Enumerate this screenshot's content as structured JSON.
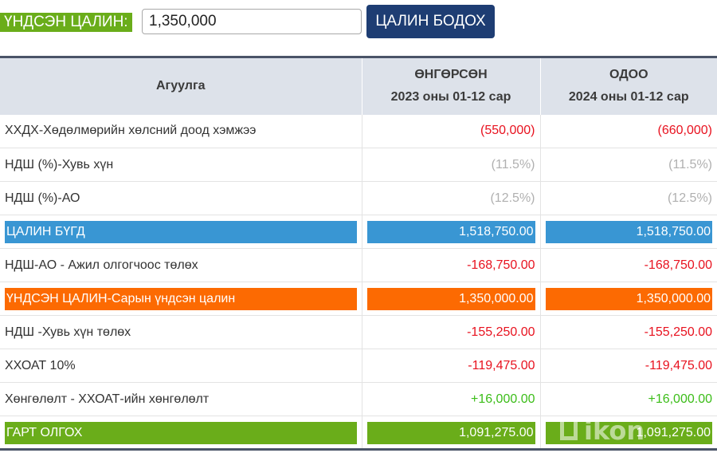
{
  "topbar": {
    "base_salary_label": "ҮНДСЭН ЦАЛИН:",
    "salary_input_value": "1,350,000",
    "calc_button_label": "ЦАЛИН БОДОХ"
  },
  "table": {
    "headers": {
      "content": "Агуулга",
      "past": {
        "title": "ӨНГӨРСӨН",
        "period": "2023 оны 01-12 сар"
      },
      "current": {
        "title": "ОДОО",
        "period": "2024 оны 01-12 сар"
      }
    },
    "rows": [
      {
        "label": "ХХДХ-Хөдөлмөрийн хөлсний доод хэмжээ",
        "past": "(550,000)",
        "current": "(660,000)",
        "style": "red"
      },
      {
        "label": "НДШ (%)-Хувь хүн",
        "past": "(11.5%)",
        "current": "(11.5%)",
        "style": "gray"
      },
      {
        "label": "НДШ (%)-АО",
        "past": "(12.5%)",
        "current": "(12.5%)",
        "style": "gray"
      },
      {
        "label": "ЦАЛИН БҮГД",
        "past": "1,518,750.00",
        "current": "1,518,750.00",
        "style": "blue"
      },
      {
        "label": "НДШ-АО - Ажил олгогчоос төлөх",
        "past": "-168,750.00",
        "current": "-168,750.00",
        "style": "red"
      },
      {
        "label": "ҮНДСЭН ЦАЛИН-Сарын үндсэн цалин",
        "past": "1,350,000.00",
        "current": "1,350,000.00",
        "style": "orange"
      },
      {
        "label": "НДШ -Хувь хүн төлөх",
        "past": "-155,250.00",
        "current": "-155,250.00",
        "style": "red"
      },
      {
        "label": "ХХОАТ 10%",
        "past": "-119,475.00",
        "current": "-119,475.00",
        "style": "red"
      },
      {
        "label": "Хөнгөлөлт - ХХОАТ-ийн хөнгөлөлт",
        "past": "+16,000.00",
        "current": "+16,000.00",
        "style": "green"
      },
      {
        "label": "ГАРТ ОЛГОХ",
        "past": "1,091,275.00",
        "current": "1,091,275.00",
        "style": "greenband"
      }
    ]
  },
  "watermark": {
    "text": "ikon"
  },
  "colors": {
    "green_accent": "#6aad1a",
    "navy_button": "#1e3d73",
    "blue_band": "#3996d3",
    "orange_band": "#fc6a02",
    "negative_red": "#e8121f",
    "positive_green": "#3cbd19"
  }
}
